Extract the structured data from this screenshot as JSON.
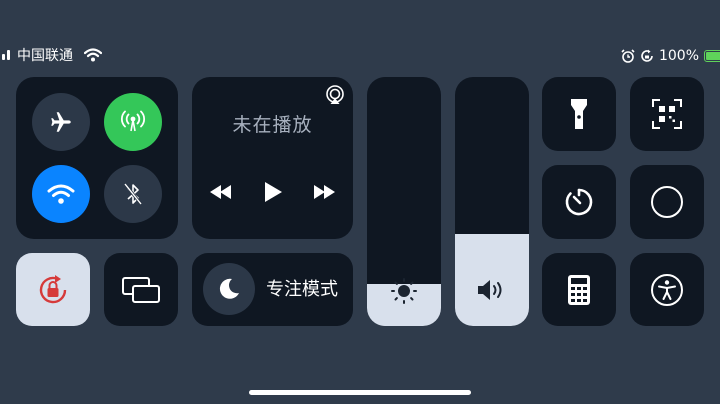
{
  "status_bar": {
    "carrier": "中国联通",
    "battery_percent": "100%",
    "icons": [
      "signal-icon",
      "wifi-icon",
      "alarm-icon",
      "rotation-lock-icon",
      "battery-charging-icon"
    ]
  },
  "connectivity": {
    "airplane": {
      "icon": "airplane-icon",
      "on": false
    },
    "cellular": {
      "icon": "cellular-antenna-icon",
      "on": true,
      "color": "#34c759"
    },
    "wifi": {
      "icon": "wifi-icon",
      "on": true,
      "color": "#0a84ff"
    },
    "bluetooth": {
      "icon": "bluetooth-off-icon",
      "on": false
    }
  },
  "media": {
    "status": "未在播放",
    "icons": [
      "airplay-icon",
      "rewind-icon",
      "play-icon",
      "fast-forward-icon"
    ]
  },
  "rotation_lock": {
    "icon": "rotation-lock-icon",
    "on": true,
    "color": "#d63a3a"
  },
  "screen_mirroring": {
    "icon": "screen-mirroring-icon"
  },
  "focus": {
    "label": "专注模式",
    "icon": "moon-icon"
  },
  "brightness": {
    "icon": "sun-icon",
    "level": 0.17
  },
  "volume": {
    "icon": "speaker-icon",
    "level": 0.37
  },
  "controls": [
    {
      "name": "flashlight",
      "icon": "flashlight-icon"
    },
    {
      "name": "qr-scanner",
      "icon": "qr-code-icon"
    },
    {
      "name": "timer",
      "icon": "timer-icon"
    },
    {
      "name": "screen-recording",
      "icon": "record-icon"
    },
    {
      "name": "calculator",
      "icon": "calculator-icon"
    },
    {
      "name": "accessibility",
      "icon": "accessibility-icon"
    }
  ]
}
